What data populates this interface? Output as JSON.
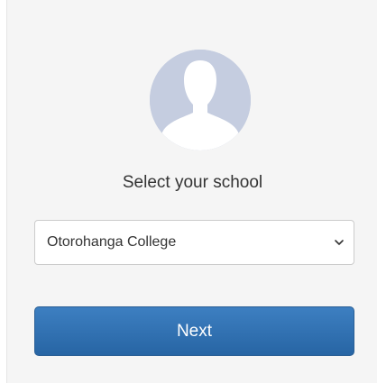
{
  "avatar": {
    "icon": "user-silhouette-icon",
    "bg_color": "#c5cde0"
  },
  "school_picker": {
    "title": "Select your school",
    "selected": "Otorohanga College",
    "chevron_icon": "chevron-down-icon"
  },
  "actions": {
    "next_label": "Next",
    "button_color": "#2d6ead"
  }
}
